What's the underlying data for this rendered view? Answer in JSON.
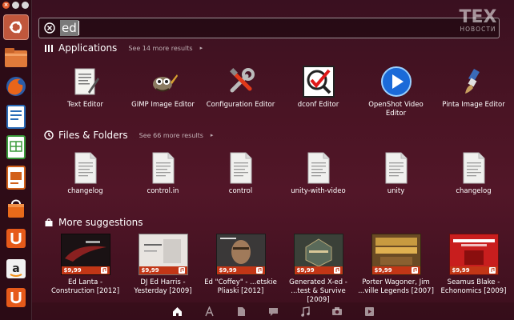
{
  "search": {
    "query": "ed"
  },
  "logo": {
    "top": "TEX",
    "bottom": "НОВОСТИ"
  },
  "applications": {
    "title": "Applications",
    "more": "See 14 more results",
    "items": [
      {
        "label": "Text Editor",
        "icon": "text-editor-icon"
      },
      {
        "label": "GIMP Image Editor",
        "icon": "gimp-icon"
      },
      {
        "label": "Configuration Editor",
        "icon": "configuration-editor-icon"
      },
      {
        "label": "dconf Editor",
        "icon": "dconf-editor-icon"
      },
      {
        "label": "OpenShot Video Editor",
        "icon": "openshot-icon"
      },
      {
        "label": "Pinta Image Editor",
        "icon": "pinta-icon"
      }
    ]
  },
  "files": {
    "title": "Files & Folders",
    "more": "See 66 more results",
    "items": [
      {
        "label": "changelog"
      },
      {
        "label": "control.in"
      },
      {
        "label": "control"
      },
      {
        "label": "unity-with-video"
      },
      {
        "label": "unity"
      },
      {
        "label": "changelog"
      }
    ]
  },
  "suggestions": {
    "title": "More suggestions",
    "items": [
      {
        "label": "Ed Lanta - Construction [2012]",
        "price": "$9,99",
        "color": "#1a1214"
      },
      {
        "label": "DJ Ed Harris - Yesterday [2009]",
        "price": "$9,99",
        "color": "#e8e4e0"
      },
      {
        "label": "Ed \"Coffey\" - ...etskie Pliaski [2012]",
        "price": "$9,99",
        "color": "#3a3838"
      },
      {
        "label": "Generated X-ed - ...test & Survive [2009]",
        "price": "$9,99",
        "color": "#3a4038"
      },
      {
        "label": "Porter Wagoner, Jim ...ville Legends [2007]",
        "price": "$9,99",
        "color": "#6a4a24"
      },
      {
        "label": "Seamus Blake - Echonomics [2009]",
        "price": "$9,99",
        "color": "#c81e1e"
      }
    ]
  },
  "colors": {
    "accent": "#c0573c",
    "price_bar": "#c23616"
  }
}
